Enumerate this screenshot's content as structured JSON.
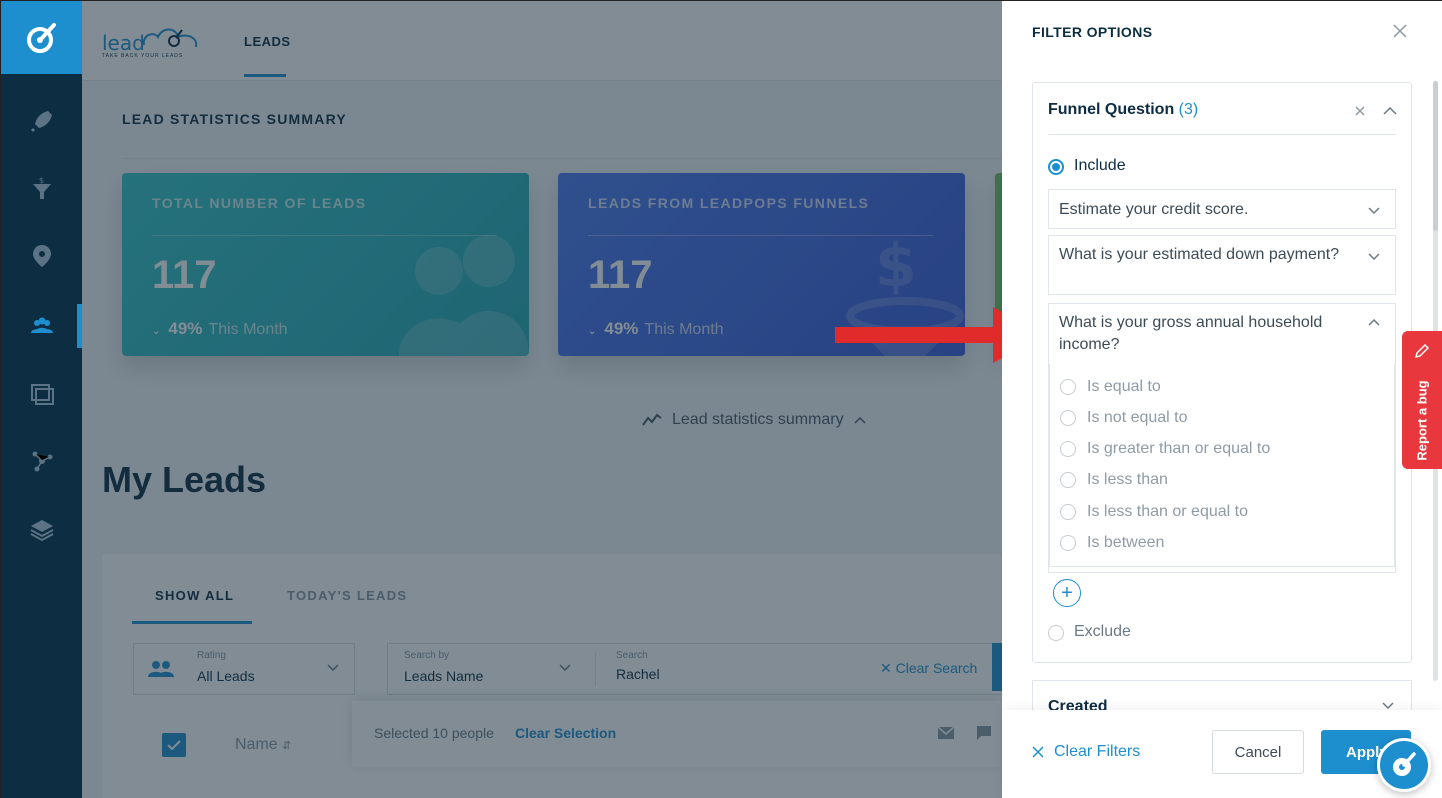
{
  "header": {
    "brand_word": "lead",
    "brand_tagline": "TAKE BACK YOUR LEADS",
    "tab": "LEADS"
  },
  "summary": {
    "title": "LEAD STATISTICS SUMMARY",
    "cards": [
      {
        "label": "TOTAL NUMBER OF LEADS",
        "value": "117",
        "pct": "49%",
        "period": "This Month"
      },
      {
        "label": "LEADS FROM LEADPOPS FUNNELS",
        "value": "117",
        "pct": "49%",
        "period": "This Month"
      }
    ],
    "toggle_label": "Lead statistics summary"
  },
  "leads": {
    "title": "My Leads",
    "tabs": [
      "SHOW ALL",
      "TODAY'S LEADS"
    ],
    "rating_label": "Rating",
    "rating_value": "All Leads",
    "search_by_label": "Search by",
    "search_by_value": "Leads Name",
    "search_label": "Search",
    "search_value": "Rachel",
    "clear_search": "Clear Search",
    "selected_text": "Selected 10 people",
    "clear_selection": "Clear Selection",
    "name_column": "Name"
  },
  "drawer": {
    "title": "FILTER OPTIONS",
    "funnel_question": {
      "title": "Funnel Question",
      "count": "(3)",
      "include_label": "Include",
      "exclude_label": "Exclude",
      "questions": [
        "Estimate your credit score.",
        "What is your estimated down payment?",
        "What is your gross annual household income?"
      ],
      "options": [
        "Is equal to",
        "Is not equal to",
        "Is greater than or equal to",
        "Is less than",
        "Is less than or equal to",
        "Is between"
      ]
    },
    "created_title": "Created",
    "clear_filters": "Clear Filters",
    "cancel": "Cancel",
    "apply": "Apply"
  },
  "report_bug": "Report a bug",
  "colors": {
    "accent": "#1d8fcf",
    "rail": "#0d2d43",
    "bug": "#e8383d",
    "arrow": "#e12b2b"
  }
}
